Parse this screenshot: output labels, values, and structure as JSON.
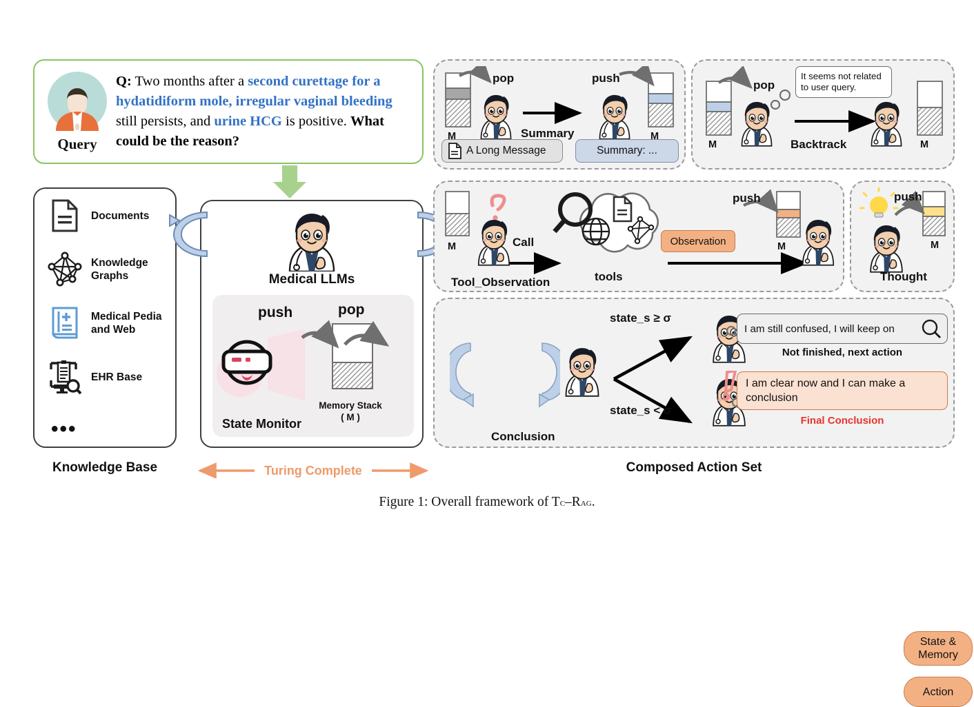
{
  "query": {
    "avatar_label": "Query",
    "prefix": "Q:",
    "t1": " Two months after a ",
    "h1": "second curettage for a hydatidiform mole, irregular vaginal bleeding",
    "t2": " still persists, and ",
    "h2": "urine HCG",
    "t3": " is positive. ",
    "b1": "What could be the reason?"
  },
  "knowledge_base": {
    "title": "Knowledge Base",
    "items": [
      {
        "icon": "document-icon",
        "label": "Documents"
      },
      {
        "icon": "knowledge-graph-icon",
        "label": "Knowledge Graphs"
      },
      {
        "icon": "medical-book-icon",
        "label": "Medical Pedia and Web"
      },
      {
        "icon": "ehr-monitor-icon",
        "label": "EHR Base"
      }
    ],
    "ellipsis": "•••"
  },
  "center": {
    "llm_label": "Medical LLMs",
    "state_monitor_label": "State Monitor",
    "push": "push",
    "pop": "pop",
    "memory_stack_line1": "Memory Stack",
    "memory_stack_line2": "( M )",
    "turing_complete": "Turing Complete"
  },
  "actions": {
    "title": "Composed Action Set",
    "summary": {
      "pop": "pop",
      "push": "push",
      "arrow_label": "Summary",
      "m_left": "M",
      "m_right": "M",
      "long_message": "A Long Message",
      "summary_box": "Summary: ..."
    },
    "backtrack": {
      "pop": "pop",
      "arrow_label": "Backtrack",
      "m_left": "M",
      "m_right": "M",
      "thought_bubble": "It seems not related to user query."
    },
    "tool_observation": {
      "title": "Tool_Observation",
      "m_left": "M",
      "m_right": "M",
      "call": "Call",
      "tools": "tools",
      "observation": "Observation",
      "push": "push"
    },
    "thought": {
      "title": "Thought",
      "push": "push",
      "m": "M"
    },
    "conclusion": {
      "title": "Conclusion",
      "state_memory": "State & Memory",
      "action": "Action",
      "cond_high": "state_s ≥ σ",
      "cond_low": "state_s < σ",
      "not_finished_bubble": "I am still confused, I will keep on",
      "not_finished_label": "Not finished, next action",
      "final_bubble": "I am clear now and I can make a conclusion",
      "final_label": "Final Conclusion"
    }
  },
  "caption": {
    "prefix": "Figure 1: Overall framework of ",
    "name_a": "T",
    "name_b": "c",
    "dash": "–",
    "name_c": "R",
    "name_d": "ag",
    "period": "."
  },
  "colors": {
    "query_border": "#86c561",
    "highlight_blue": "#3272c6",
    "accent_orange": "#ef9a6b",
    "arrow_blue": "#bdd0e8",
    "final_red": "#e8352a",
    "panel_bg": "#f2f2f2"
  }
}
